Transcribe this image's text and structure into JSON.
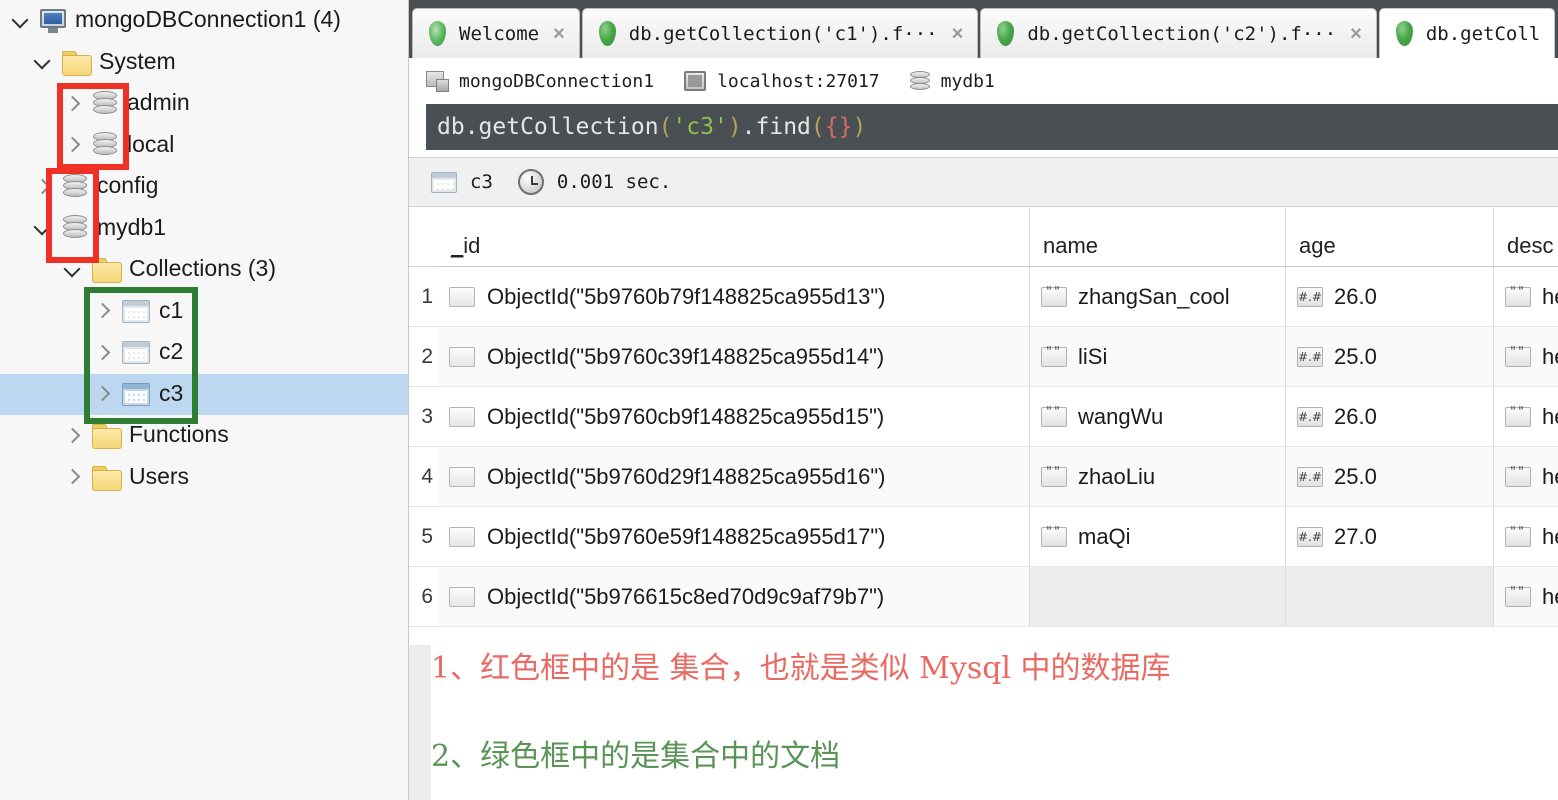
{
  "tree": {
    "items": [
      {
        "label": "mongoDBConnection1 (4)",
        "icon": "monitor-icon",
        "indent": 0,
        "twisty": "down",
        "selected": false
      },
      {
        "label": "System",
        "icon": "folder-icon",
        "indent": 1,
        "twisty": "down",
        "selected": false
      },
      {
        "label": "admin",
        "icon": "database-icon",
        "indent": 2,
        "twisty": "right",
        "selected": false
      },
      {
        "label": "local",
        "icon": "database-icon",
        "indent": 2,
        "twisty": "right",
        "selected": false
      },
      {
        "label": "config",
        "icon": "database-icon",
        "indent": 1,
        "twisty": "right",
        "selected": false
      },
      {
        "label": "mydb1",
        "icon": "database-icon",
        "indent": 1,
        "twisty": "down",
        "selected": false
      },
      {
        "label": "Collections (3)",
        "icon": "folder-icon",
        "indent": 2,
        "twisty": "down",
        "selected": false
      },
      {
        "label": "c1",
        "icon": "collection-icon",
        "indent": 3,
        "twisty": "right",
        "selected": false
      },
      {
        "label": "c2",
        "icon": "collection-icon",
        "indent": 3,
        "twisty": "right",
        "selected": false
      },
      {
        "label": "c3",
        "icon": "collection-icon",
        "indent": 3,
        "twisty": "right",
        "selected": true
      },
      {
        "label": "Functions",
        "icon": "folder-icon",
        "indent": 2,
        "twisty": "right",
        "selected": false
      },
      {
        "label": "Users",
        "icon": "folder-icon",
        "indent": 2,
        "twisty": "right",
        "selected": false
      }
    ]
  },
  "annotation_boxes": {
    "red_color": "#ee3124",
    "green_color": "#2f7d32"
  },
  "tabs": [
    {
      "label": "Welcome",
      "icon": "mongodb-leaf-icon",
      "active": false,
      "close": "×"
    },
    {
      "label": "db.getCollection('c1').f···",
      "icon": "mongodb-leaf-icon",
      "active": false,
      "close": "×"
    },
    {
      "label": "db.getCollection('c2').f···",
      "icon": "mongodb-leaf-icon",
      "active": false,
      "close": "×"
    },
    {
      "label": "db.getColl",
      "icon": "mongodb-leaf-icon",
      "active": true,
      "close": ""
    }
  ],
  "connection_bar": {
    "connection": "mongoDBConnection1",
    "host": "localhost:27017",
    "database": "mydb1"
  },
  "query": {
    "t1": "db.getCollection",
    "t2": "(",
    "t3": "'c3'",
    "t4": ")",
    "t5": ".find",
    "t6": "(",
    "t7": "{}",
    "t8": ")"
  },
  "result_bar": {
    "collection": "c3",
    "time": "0.001 sec."
  },
  "grid": {
    "columns": [
      "_id",
      "name",
      "age",
      "desc"
    ],
    "rows": [
      {
        "n": "1",
        "id": "ObjectId(\"5b9760b79f148825ca955d13\")",
        "name": "zhangSan_cool",
        "age": "26.0",
        "desc": "hell"
      },
      {
        "n": "2",
        "id": "ObjectId(\"5b9760c39f148825ca955d14\")",
        "name": "liSi",
        "age": "25.0",
        "desc": "hell"
      },
      {
        "n": "3",
        "id": "ObjectId(\"5b9760cb9f148825ca955d15\")",
        "name": "wangWu",
        "age": "26.0",
        "desc": "hell"
      },
      {
        "n": "4",
        "id": "ObjectId(\"5b9760d29f148825ca955d16\")",
        "name": "zhaoLiu",
        "age": "25.0",
        "desc": "hell"
      },
      {
        "n": "5",
        "id": "ObjectId(\"5b9760e59f148825ca955d17\")",
        "name": "maQi",
        "age": "27.0",
        "desc": "hell"
      },
      {
        "n": "6",
        "id": "ObjectId(\"5b976615c8ed70d9c9af79b7\")",
        "name": "",
        "age": "",
        "desc": "hell"
      }
    ],
    "badges": {
      "doc": "",
      "string": "\"\"",
      "number": "#.#"
    }
  },
  "annotations": {
    "line1": "1、红色框中的是 集合，也就是类似 Mysql 中的数据库",
    "line1_color": "#e96a62",
    "line2": "2、绿色框中的是集合中的文档",
    "line2_color": "#5a9457"
  }
}
